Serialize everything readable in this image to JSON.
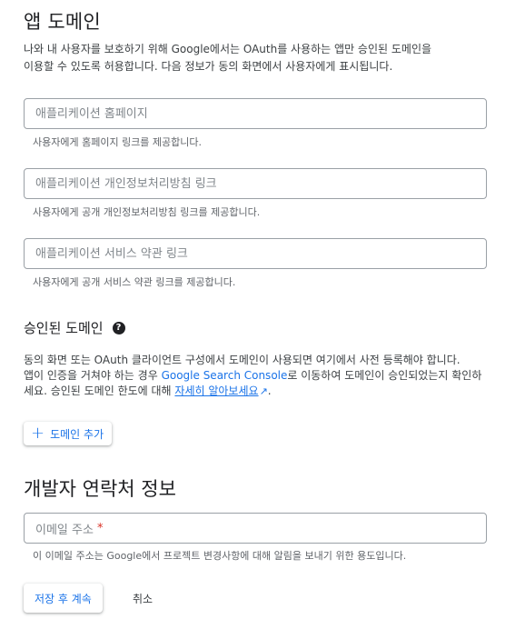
{
  "app_domain": {
    "title": "앱 도메인",
    "intro_line1": "나와 내 사용자를 보호하기 위해 Google에서는 OAuth를 사용하는 앱만 승인된 도메인을",
    "intro_line2": "이용할 수 있도록 허용합니다. 다음 정보가 동의 화면에서 사용자에게 표시됩니다.",
    "fields": [
      {
        "placeholder": "애플리케이션 홈페이지",
        "hint": "사용자에게 홈페이지 링크를 제공합니다."
      },
      {
        "placeholder": "애플리케이션 개인정보처리방침 링크",
        "hint": "사용자에게 공개 개인정보처리방침 링크를 제공합니다."
      },
      {
        "placeholder": "애플리케이션 서비스 약관 링크",
        "hint": "사용자에게 공개 서비스 약관 링크를 제공합니다."
      }
    ]
  },
  "authorized_domains": {
    "title": "승인된 도메인",
    "help_icon": "help-circle-icon",
    "desc_line1": "동의 화면 또는 OAuth 클라이언트 구성에서 도메인이 사용되면 여기에서 사전 등록해야 합니다.",
    "desc_line2_pre": "앱이 인증을 거쳐야 하는 경우 ",
    "desc_link1": "Google Search Console",
    "desc_line2_post": "로 이동하여 도메인이 승인되었는지 확인하",
    "desc_line3_pre": "세요. 승인된 도메인 한도에 대해 ",
    "desc_link2": "자세히 알아보세요",
    "desc_line3_post": ".",
    "add_button": "도메인 추가",
    "add_icon": "plus-icon",
    "external_icon": "external-link-icon"
  },
  "developer_contact": {
    "title": "개발자 연락처 정보",
    "email_placeholder": "이메일 주소",
    "required_mark": "*",
    "hint": "이 이메일 주소는 Google에서 프로젝트 변경사항에 대해 알림을 보내기 위한 용도입니다."
  },
  "actions": {
    "save": "저장 후 계속",
    "cancel": "취소"
  },
  "colors": {
    "accent": "#1a73e8",
    "required": "#d93025",
    "border": "#9aa0a6"
  }
}
